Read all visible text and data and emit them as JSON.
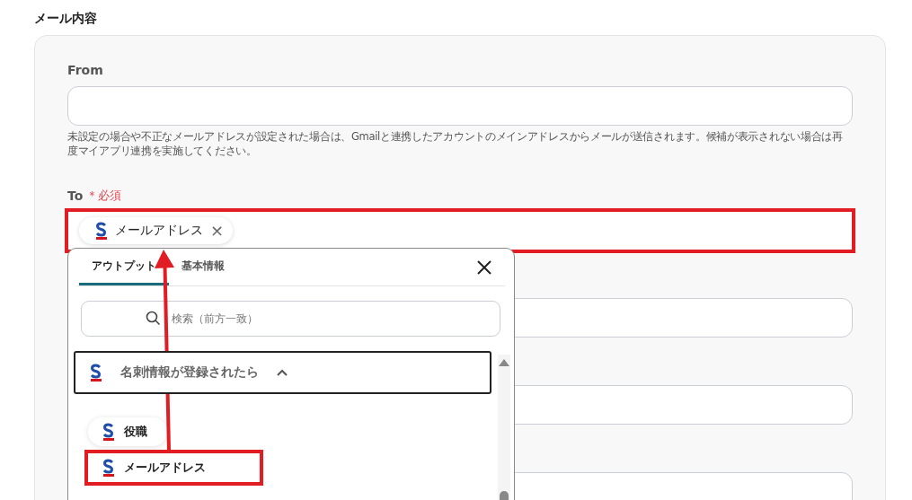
{
  "heading": "メール内容",
  "from": {
    "label": "From",
    "hint": "未設定の場合や不正なメールアドレスが設定された場合は、Gmailと連携したアカウントのメインアドレスからメールが送信されます。候補が表示されない場合は再度マイアプリ連携を実施してください。"
  },
  "to": {
    "label": "To",
    "required_mark": "＊",
    "required": "必須",
    "highlighted": true,
    "chips": [
      {
        "label": "メールアドレス",
        "remove": "×"
      }
    ]
  },
  "popup": {
    "tabs": [
      {
        "label": "アウトプット",
        "selected": true
      },
      {
        "label": "基本情報",
        "selected": false
      }
    ],
    "search": {
      "placeholder": "検索（前方一致）"
    },
    "group": {
      "title": "名刺情報が登録されたら",
      "expanded": true
    },
    "items": [
      {
        "label": "役職",
        "highlighted": false
      },
      {
        "label": "メールアドレス",
        "highlighted": true
      }
    ]
  }
}
